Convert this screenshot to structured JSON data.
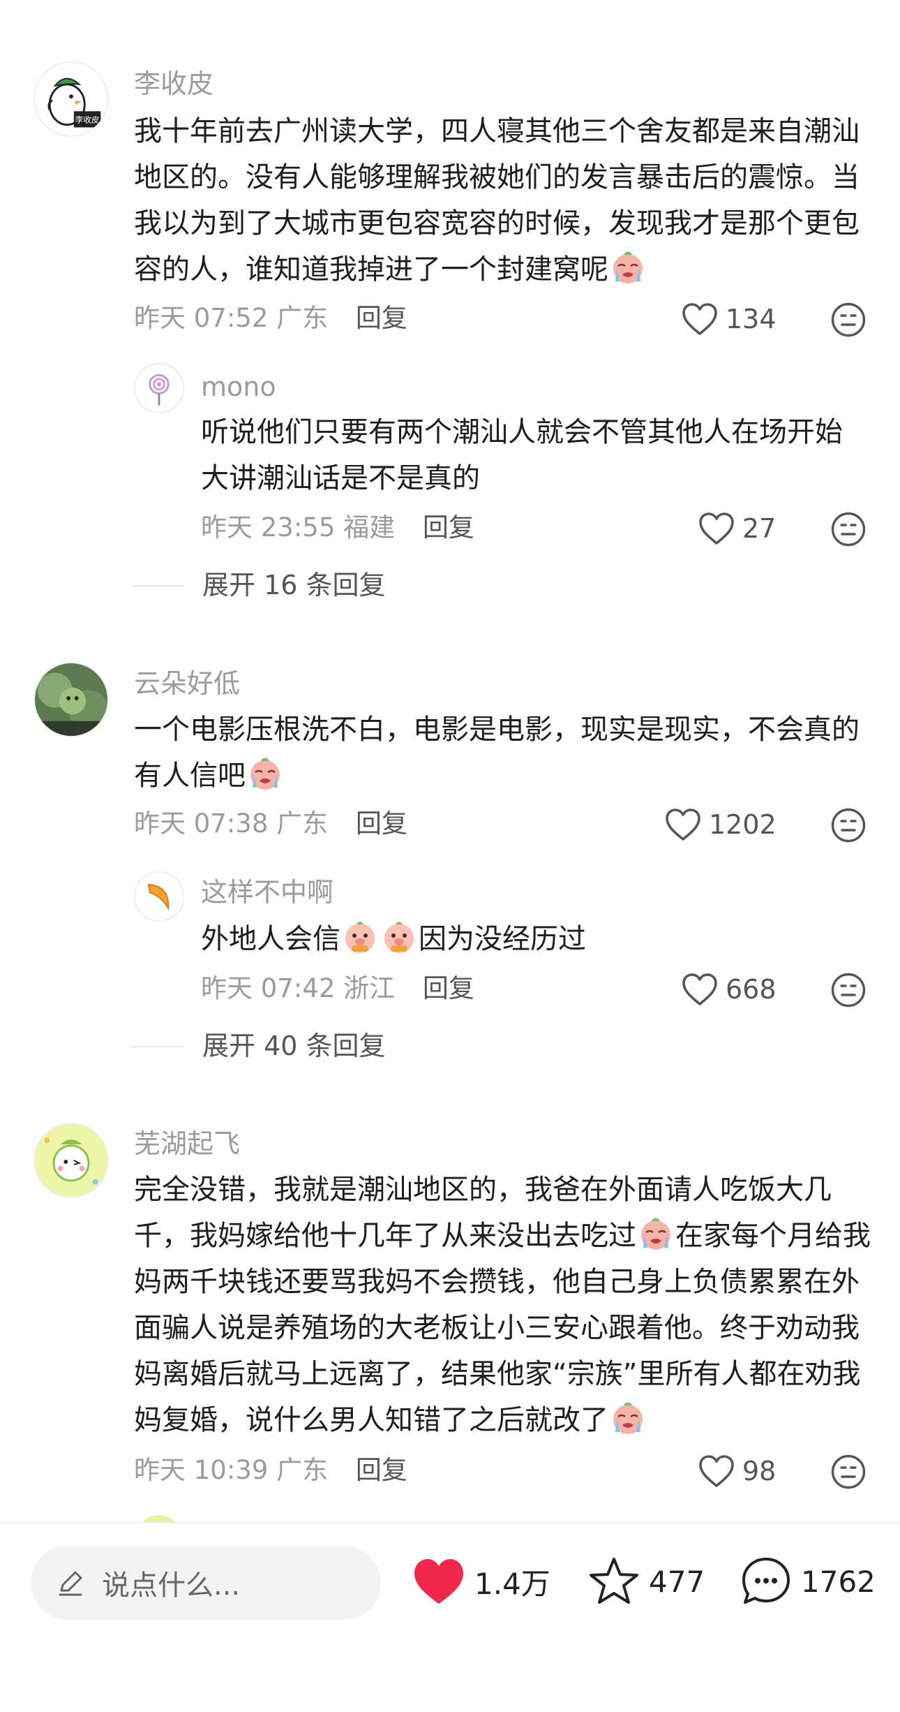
{
  "comments": [
    {
      "username": "李收皮",
      "avatar_label": "李收皮",
      "text": "我十年前去广州读大学，四人寝其他三个舍友都是来自潮汕地区的。没有人能够理解我被她们的发言暴击后的震惊。当我以为到了大城市更包容宽容的时候，发现我才是那个更包容的人，谁知道我掉进了一个封建窝呢",
      "time": "昨天 07:52",
      "location": "广东",
      "reply_label": "回复",
      "likes": "134",
      "reply": {
        "username": "mono",
        "text": "听说他们只要有两个潮汕人就会不管其他人在场开始大讲潮汕话是不是真的",
        "time": "昨天 23:55",
        "location": "福建",
        "reply_label": "回复",
        "likes": "27"
      },
      "expand_label": "展开 16 条回复"
    },
    {
      "username": "云朵好低",
      "text": "一个电影压根洗不白，电影是电影，现实是现实，不会真的有人信吧",
      "time": "昨天 07:38",
      "location": "广东",
      "reply_label": "回复",
      "likes": "1202",
      "reply": {
        "username": "这样不中啊",
        "text_part1": "外地人会信",
        "text_part2": "因为没经历过",
        "time": "昨天 07:42",
        "location": "浙江",
        "reply_label": "回复",
        "likes": "668"
      },
      "expand_label": "展开 40 条回复"
    },
    {
      "username": "芜湖起飞",
      "text_part1": "完全没错，我就是潮汕地区的，我爸在外面请人吃饭大几千，我妈嫁给他十几年了从来没出去吃过",
      "text_part2": "在家每个月给我妈两千块钱还要骂我妈不会攒钱，他自己身上负债累累在外面骗人说是养殖场的大老板让小三安心跟着他。终于劝动我妈离婚后就马上远离了，结果他家“宗族”里所有人都在劝我妈复婚，说什么男人知错了之后就改了",
      "time": "昨天 10:39",
      "location": "广东",
      "reply_label": "回复",
      "likes": "98"
    }
  ],
  "bottom_bar": {
    "input_placeholder": "说点什么...",
    "likes": "1.4万",
    "favorites": "477",
    "comments": "1762",
    "like_color": "#f2284a"
  },
  "icons": [
    "heart-outline-icon",
    "meh-face-icon",
    "pencil-icon",
    "heart-filled-icon",
    "star-icon",
    "chat-bubble-icon",
    "crying-emoji",
    "pig-emoji"
  ]
}
